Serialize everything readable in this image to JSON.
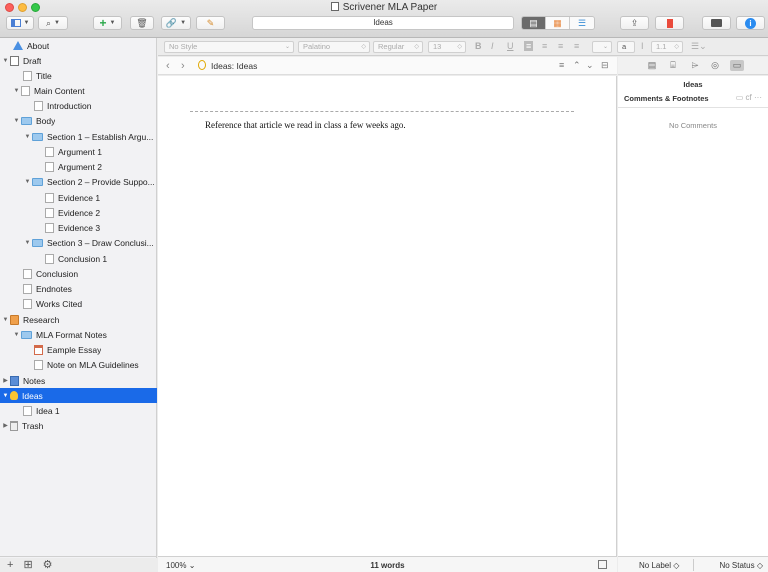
{
  "window": {
    "title": "Scrivener MLA Paper"
  },
  "toolbar": {
    "title_field": "Ideas",
    "add_icon": "+",
    "trash_icon": "🗑",
    "attach_icon": "🔗",
    "compose_icon": "✎",
    "share_icon": "⇪",
    "bookmark_icon": "🔖",
    "compile_icon": "◧",
    "info_icon": "i"
  },
  "binder": {
    "items": [
      {
        "label": "About"
      },
      {
        "label": "Draft"
      },
      {
        "label": "Title"
      },
      {
        "label": "Main Content"
      },
      {
        "label": "Introduction"
      },
      {
        "label": "Body"
      },
      {
        "label": "Section 1 – Establish Argu..."
      },
      {
        "label": "Argument 1"
      },
      {
        "label": "Argument 2"
      },
      {
        "label": "Section 2 – Provide Suppo..."
      },
      {
        "label": "Evidence 1"
      },
      {
        "label": "Evidence 2"
      },
      {
        "label": "Evidence 3"
      },
      {
        "label": "Section 3 – Draw Conclusi..."
      },
      {
        "label": "Conclusion 1"
      },
      {
        "label": "Conclusion"
      },
      {
        "label": "Endnotes"
      },
      {
        "label": "Works Cited"
      },
      {
        "label": "Research"
      },
      {
        "label": "MLA Format Notes"
      },
      {
        "label": "Eample Essay"
      },
      {
        "label": "Note on MLA Guidelines"
      },
      {
        "label": "Notes"
      },
      {
        "label": "Ideas"
      },
      {
        "label": "Idea 1"
      },
      {
        "label": "Trash"
      }
    ],
    "footer": {
      "add": "+",
      "folder": "⊞",
      "settings": "⚙"
    }
  },
  "formatbar": {
    "style": "No Style",
    "font": "Palatino",
    "weight": "Regular",
    "size": "13",
    "bold": "B",
    "italic": "I",
    "underline": "U",
    "text_color": "a",
    "line_spacing": "1.1"
  },
  "editor": {
    "crumb_prefix": "Ideas:",
    "crumb_title": "Ideas",
    "text": "Reference that article we read in class a few weeks ago.",
    "zoom": "100%",
    "word_count": "11 words"
  },
  "inspector": {
    "title": "Ideas",
    "section": "Comments & Footnotes",
    "section_ctl": "cf",
    "empty": "No Comments",
    "label": "No Label",
    "status": "No Status"
  },
  "colors": {
    "selection": "#1a6ae8",
    "folder": "#9dc9ee",
    "bulb": "#f9c531"
  }
}
